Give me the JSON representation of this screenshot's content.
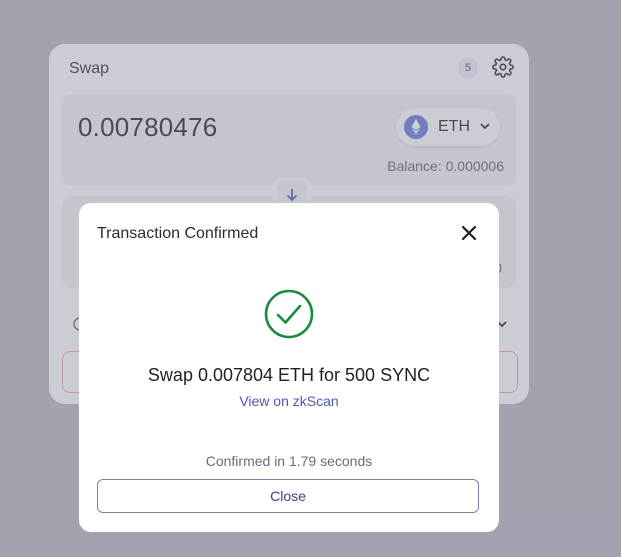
{
  "swap_card": {
    "title": "Swap",
    "slippage_badge": "5",
    "input": {
      "amount": "0.00780476",
      "token": "ETH",
      "balance": "Balance: 0.000006"
    },
    "output": {
      "balance_fragment": "0"
    }
  },
  "modal": {
    "title": "Transaction Confirmed",
    "summary": "Swap 0.007804 ETH for 500 SYNC",
    "explorer_link": "View on zkScan",
    "confirmed_time": "Confirmed in 1.79 seconds",
    "close_button": "Close"
  },
  "colors": {
    "success_green": "#1a8a3c",
    "link_blue": "#4d57b3",
    "eth_blue": "#6275d6"
  },
  "icons": [
    "gear-icon",
    "eth-logo-icon",
    "chevron-down-icon",
    "arrow-down-icon",
    "info-icon",
    "close-icon",
    "check-circle-icon"
  ]
}
